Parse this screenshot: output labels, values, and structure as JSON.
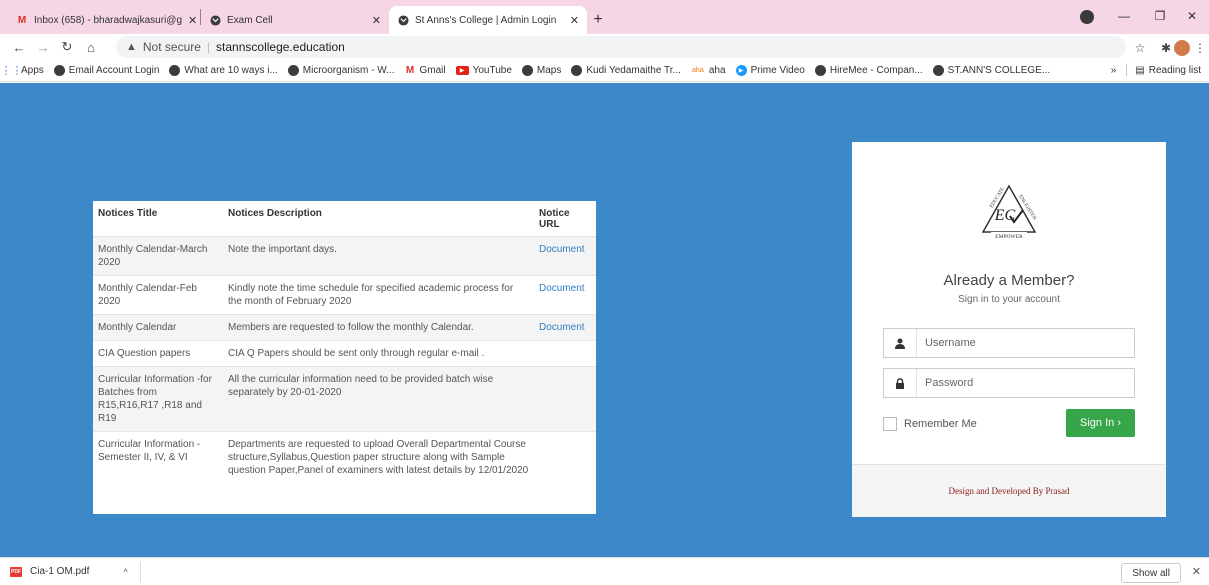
{
  "browser": {
    "tabs": [
      {
        "title": "Inbox (658) - bharadwajkasuri@g",
        "icon": "gmail-icon",
        "active": false
      },
      {
        "title": "Exam Cell",
        "icon": "globe-icon",
        "active": false
      },
      {
        "title": "St Anns's College | Admin Login",
        "icon": "globe-icon",
        "active": true
      }
    ],
    "new_tab": "+",
    "address": {
      "security_label": "Not secure",
      "url": "stannscollege.education"
    },
    "bookmarks": [
      {
        "label": "Apps",
        "icon": "apps-grid-icon"
      },
      {
        "label": "Email Account Login",
        "icon": "globe-icon"
      },
      {
        "label": "What are 10 ways i...",
        "icon": "globe-icon"
      },
      {
        "label": "Microorganism - W...",
        "icon": "globe-icon"
      },
      {
        "label": "Gmail",
        "icon": "gmail-icon"
      },
      {
        "label": "YouTube",
        "icon": "youtube-icon"
      },
      {
        "label": "Maps",
        "icon": "globe-icon"
      },
      {
        "label": "Kudi Yedamaithe Tr...",
        "icon": "globe-icon"
      },
      {
        "label": "aha",
        "icon": "aha-icon"
      },
      {
        "label": "Prime Video",
        "icon": "prime-video-icon"
      },
      {
        "label": "HireMee - Compan...",
        "icon": "globe-icon"
      },
      {
        "label": "ST.ANN'S COLLEGE...",
        "icon": "globe-icon"
      }
    ],
    "bookmarks_more": "»",
    "reading_list": "Reading list"
  },
  "notices": {
    "headers": {
      "title": "Notices Title",
      "description": "Notices Description",
      "url": "Notice URL"
    },
    "rows": [
      {
        "title": "Monthly Calendar-March 2020",
        "description": "Note the important days.",
        "url": "Document"
      },
      {
        "title": "Monthly Calendar-Feb 2020",
        "description": "Kindly note the time schedule for specified academic process for the month of February 2020",
        "url": "Document"
      },
      {
        "title": "Monthly Calendar",
        "description": "Members are requested to follow the monthly Calendar.",
        "url": "Document"
      },
      {
        "title": "CIA Question papers",
        "description": "CIA Q Papers should be sent only through regular e-mail .",
        "url": ""
      },
      {
        "title": "Curricular Information -for Batches from R15,R16,R17 ,R18 and R19",
        "description": "All the curricular information need to be provided batch wise separately by 20-01-2020",
        "url": ""
      },
      {
        "title": "Curricular Information - Semester II, IV, & VI",
        "description": "Departments are requested to upload Overall Departmental Course structure,Syllabus,Question paper structure along with Sample question Paper,Panel of examiners with latest details by 12/01/2020",
        "url": ""
      }
    ]
  },
  "login": {
    "logo_words": {
      "top_left": "EDUCATE",
      "top_right": "ENLIGHTEN",
      "bottom": "EMPOWER",
      "letters": "EC"
    },
    "heading": "Already a Member?",
    "subheading": "Sign in to your account",
    "username_placeholder": "Username",
    "password_placeholder": "Password",
    "remember_label": "Remember Me",
    "signin_label": "Sign In ›",
    "footer": "Design and Developed By Prasad",
    "signin_color": "#37a64a"
  },
  "downloads": {
    "file_name": "Cia-1 OM.pdf",
    "file_badge": "PDF",
    "show_all": "Show all"
  },
  "colors": {
    "page_background": "#3c88c9",
    "tabstrip": "#f5d5e6",
    "link": "#2f7fc3",
    "footer_text": "#8b1a1a"
  }
}
